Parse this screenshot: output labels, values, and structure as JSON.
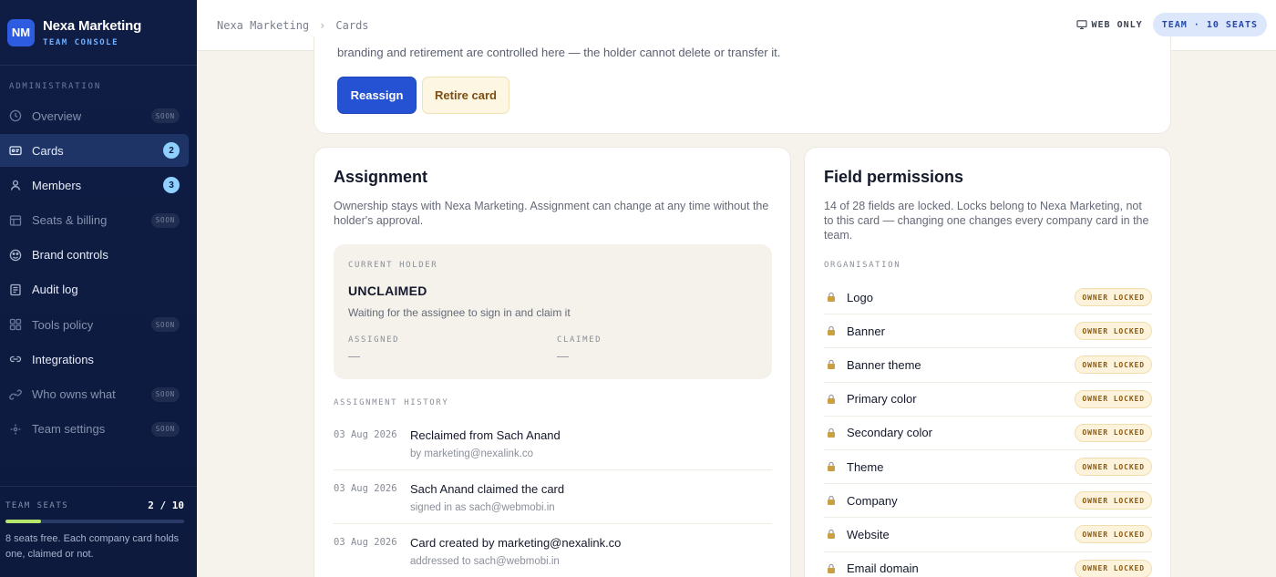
{
  "brand": {
    "initials": "NM",
    "name": "Nexa Marketing",
    "subtitle": "TEAM CONSOLE"
  },
  "sidebar": {
    "section_label": "ADMINISTRATION",
    "items": [
      {
        "label": "Overview",
        "icon": "clock-icon",
        "tag": "SOON"
      },
      {
        "label": "Cards",
        "icon": "card-icon",
        "badge": "2"
      },
      {
        "label": "Members",
        "icon": "user-icon",
        "badge": "3"
      },
      {
        "label": "Seats & billing",
        "icon": "billing-icon",
        "tag": "SOON"
      },
      {
        "label": "Brand controls",
        "icon": "palette-icon"
      },
      {
        "label": "Audit log",
        "icon": "log-icon"
      },
      {
        "label": "Tools policy",
        "icon": "grid-icon",
        "tag": "SOON"
      },
      {
        "label": "Integrations",
        "icon": "link-icon"
      },
      {
        "label": "Who owns what",
        "icon": "chain-icon",
        "tag": "SOON"
      },
      {
        "label": "Team settings",
        "icon": "settings-icon",
        "tag": "SOON"
      }
    ],
    "seats": {
      "label": "TEAM SEATS",
      "count": "2 / 10",
      "used_fraction": 0.2,
      "note": "8 seats free. Each company card holds one, claimed or not."
    }
  },
  "topbar": {
    "breadcrumb": [
      "Nexa Marketing",
      "Cards"
    ],
    "separator": "›",
    "web_only": "WEB ONLY",
    "team_pill": "TEAM · 10 SEATS"
  },
  "top_card": {
    "cut_text": "branding and retirement are controlled here — the holder cannot delete or transfer it.",
    "reassign_label": "Reassign",
    "retire_label": "Retire card"
  },
  "assignment": {
    "title": "Assignment",
    "description": "Ownership stays with Nexa Marketing. Assignment can change at any time without the holder's approval.",
    "holder": {
      "label": "CURRENT HOLDER",
      "state": "UNCLAIMED",
      "note": "Waiting for the assignee to sign in and claim it",
      "assigned_label": "ASSIGNED",
      "assigned_value": "—",
      "claimed_label": "CLAIMED",
      "claimed_value": "—"
    },
    "history_label": "ASSIGNMENT HISTORY",
    "history": [
      {
        "date": "03 Aug 2026",
        "title": "Reclaimed from Sach Anand",
        "sub": "by marketing@nexalink.co"
      },
      {
        "date": "03 Aug 2026",
        "title": "Sach Anand claimed the card",
        "sub": "signed in as sach@webmobi.in"
      },
      {
        "date": "03 Aug 2026",
        "title": "Card created by marketing@nexalink.co",
        "sub": "addressed to sach@webmobi.in"
      }
    ]
  },
  "permissions": {
    "title": "Field permissions",
    "description": "14 of 28 fields are locked. Locks belong to Nexa Marketing, not to this card — changing one changes every company card in the team.",
    "group_label": "ORGANISATION",
    "fields": [
      {
        "name": "Logo",
        "badge": "OWNER LOCKED"
      },
      {
        "name": "Banner",
        "badge": "OWNER LOCKED"
      },
      {
        "name": "Banner theme",
        "badge": "OWNER LOCKED"
      },
      {
        "name": "Primary color",
        "badge": "OWNER LOCKED"
      },
      {
        "name": "Secondary color",
        "badge": "OWNER LOCKED"
      },
      {
        "name": "Theme",
        "badge": "OWNER LOCKED"
      },
      {
        "name": "Company",
        "badge": "OWNER LOCKED"
      },
      {
        "name": "Website",
        "badge": "OWNER LOCKED"
      },
      {
        "name": "Email domain",
        "badge": "OWNER LOCKED"
      }
    ]
  },
  "colors": {
    "accent": "#2452d3",
    "sidebar_bg": "#0f1d45",
    "badge": "#8fd0ff",
    "seat_fill": "#b7e86e",
    "lock_badge": "#fdf3dc"
  }
}
